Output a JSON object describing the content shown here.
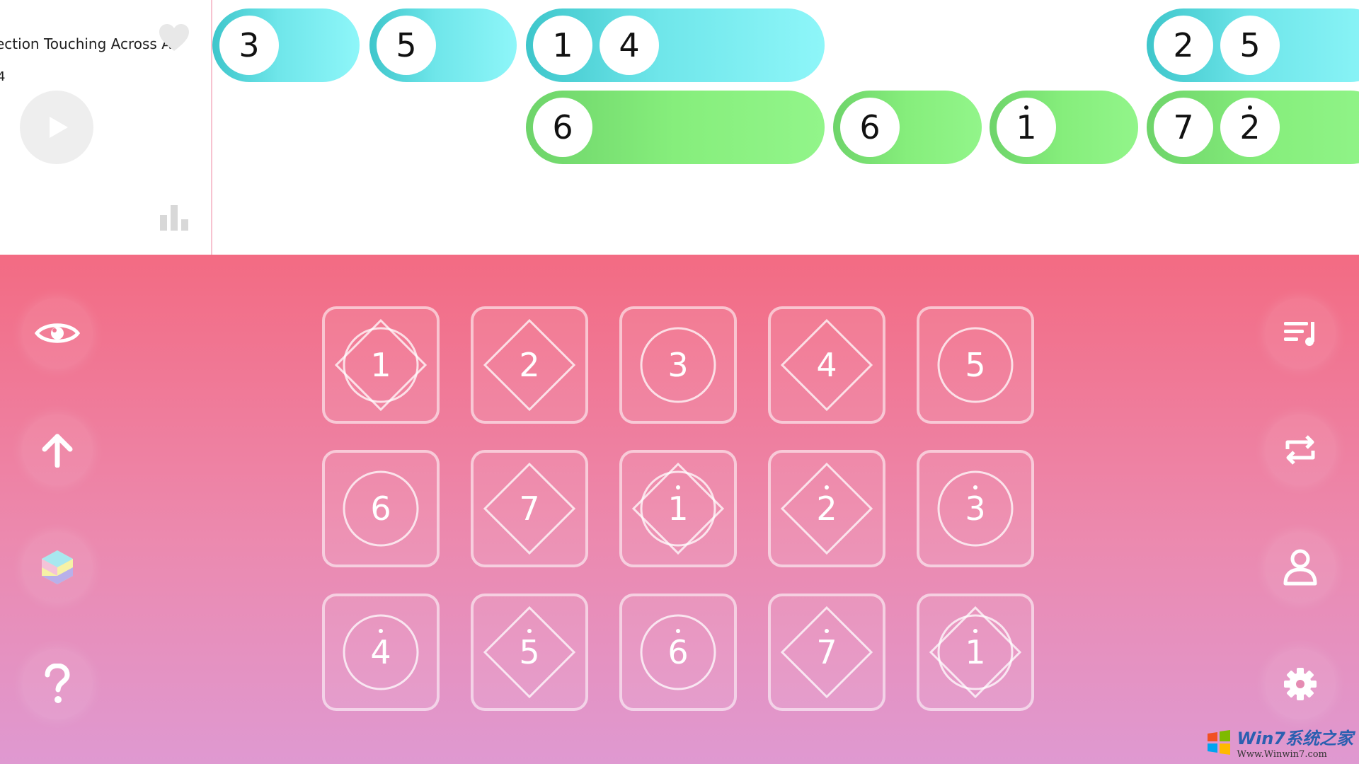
{
  "song": {
    "title": "ection Touching Across A",
    "subtitle": "4"
  },
  "timeline": {
    "top_row": [
      {
        "notes": [
          "3"
        ]
      },
      {
        "notes": [
          "5"
        ]
      },
      {
        "notes": [
          "1",
          "4"
        ]
      },
      {
        "notes": [
          "2",
          "5"
        ]
      }
    ],
    "bottom_row": [
      {
        "notes": [
          "6"
        ]
      },
      {
        "notes": [
          "6"
        ]
      },
      {
        "notes": [
          "1"
        ],
        "high": [
          true
        ]
      },
      {
        "notes": [
          "7",
          "2"
        ],
        "high": [
          false,
          true
        ]
      }
    ]
  },
  "pads": [
    {
      "label": "1",
      "shape": "diamond-circle",
      "high": false
    },
    {
      "label": "2",
      "shape": "diamond",
      "high": false
    },
    {
      "label": "3",
      "shape": "circle",
      "high": false
    },
    {
      "label": "4",
      "shape": "diamond",
      "high": false
    },
    {
      "label": "5",
      "shape": "circle",
      "high": false
    },
    {
      "label": "6",
      "shape": "circle",
      "high": false
    },
    {
      "label": "7",
      "shape": "diamond",
      "high": false
    },
    {
      "label": "1",
      "shape": "diamond-circle",
      "high": true
    },
    {
      "label": "2",
      "shape": "diamond",
      "high": true
    },
    {
      "label": "3",
      "shape": "circle",
      "high": true
    },
    {
      "label": "4",
      "shape": "circle",
      "high": true
    },
    {
      "label": "5",
      "shape": "diamond",
      "high": true
    },
    {
      "label": "6",
      "shape": "circle",
      "high": true
    },
    {
      "label": "7",
      "shape": "diamond",
      "high": true
    },
    {
      "label": "1",
      "shape": "diamond-circle",
      "high": true
    }
  ],
  "left_controls": [
    "eye-icon",
    "arrow-up-icon",
    "hexagon-skin-icon",
    "question-icon"
  ],
  "right_controls": [
    "playlist-icon",
    "repeat-icon",
    "user-icon",
    "gear-icon"
  ],
  "icons": {
    "heart": "heart-icon",
    "play": "play-icon",
    "stats": "bar-chart-icon"
  },
  "colors": {
    "cyan": "#6fe6ea",
    "green": "#86ee7c",
    "pink_top": "#f36b83",
    "pink_bottom": "#df99d1"
  },
  "watermark": {
    "main": "Win7系统之家",
    "url": "Www.Winwin7.com"
  }
}
